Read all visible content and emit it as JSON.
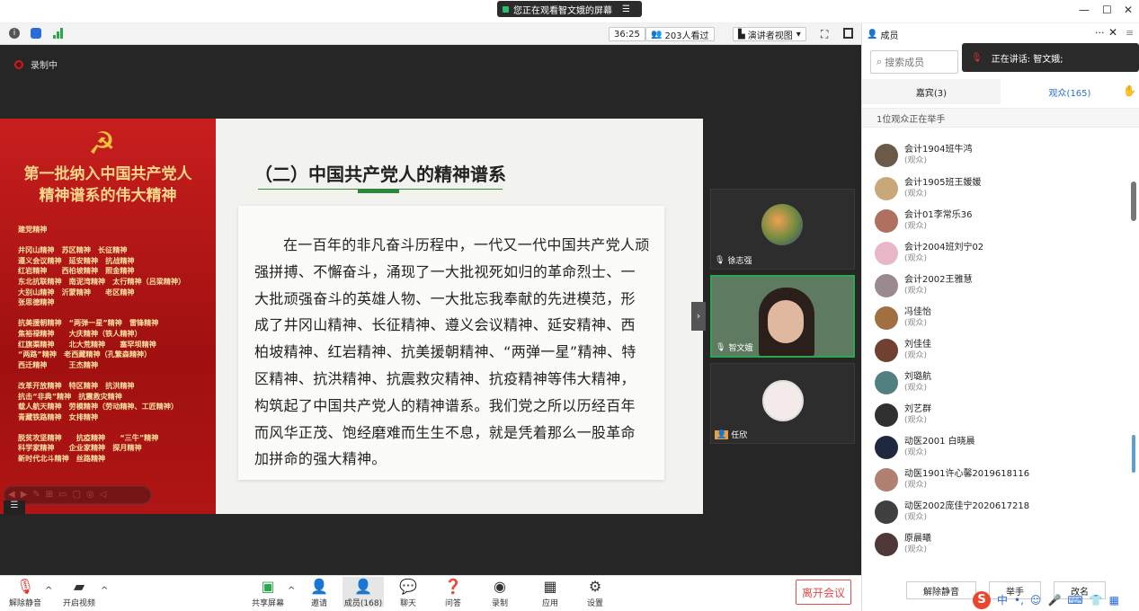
{
  "banner": {
    "text": "您正在观看智文娥的屏幕",
    "menu_icon": "hamburger-icon"
  },
  "window_controls": [
    "—",
    "☐",
    "✕"
  ],
  "toolbar": {
    "timer": "36:25",
    "viewers": "203人看过",
    "view_mode": "演讲者视图"
  },
  "recording": {
    "label": "录制中"
  },
  "slide": {
    "left_title": "第一批纳入中国共产党人\n精神谱系的伟大精神",
    "spirit_list": "建党精神\n\n井冈山精神　苏区精神　长征精神\n遵义会议精神　延安精神　抗战精神\n红岩精神　　西柏坡精神　照金精神\n东北抗联精神　南泥湾精神　太行精神（吕梁精神）\n大别山精神　沂蒙精神　　老区精神\n张思德精神\n\n抗美援朝精神　“两弹一星”精神　雷锋精神\n焦裕禄精神　　大庆精神（铁人精神）\n红旗渠精神　　北大荒精神　　塞罕坝精神\n“两路”精神　老西藏精神（孔繁森精神）\n西迁精神　　　王杰精神\n\n改革开放精神　特区精神　抗洪精神\n抗击“非典”精神　抗震救灾精神\n载人航天精神　劳模精神（劳动精神、工匠精神）\n青藏铁路精神　女排精神\n\n脱贫攻坚精神　　抗疫精神　　“三牛”精神\n科学家精神　　企业家精神　探月精神\n新时代北斗精神　丝路精神",
    "title": "（二）中国共产党人的精神谱系",
    "body": "在一百年的非凡奋斗历程中，一代又一代中国共产党人顽强拼搏、不懈奋斗，涌现了一大批视死如归的革命烈士、一大批顽强奋斗的英雄人物、一大批忘我奉献的先进模范，形成了井冈山精神、长征精神、遵义会议精神、延安精神、西柏坡精神、红岩精神、抗美援朝精神、“两弹一星”精神、特区精神、抗洪精神、抗震救灾精神、抗疫精神等伟大精神，构筑起了中国共产党人的精神谱系。我们党之所以历经百年而风华正茂、饱经磨难而生生不息，就是凭着那么一股革命加拼命的强大精神。"
  },
  "video_tiles": [
    {
      "name": "徐志强"
    },
    {
      "name": "智文娥"
    },
    {
      "name": "任欣"
    }
  ],
  "bottom_toolbar": {
    "mute": "解除静音",
    "video": "开启视频",
    "share": "共享屏幕",
    "invite": "邀请",
    "members": "成员(168)",
    "chat": "聊天",
    "qa": "问答",
    "record": "录制",
    "apps": "应用",
    "settings": "设置",
    "leave": "离开会议"
  },
  "sidebar": {
    "header": "成员",
    "more": "···",
    "search_placeholder": "搜索成员",
    "speaking": "正在讲话: 智文娥;",
    "tab_guests": "嘉宾(3)",
    "tab_audience": "观众(165)",
    "raise_notice": "1位观众正在举手",
    "members": [
      {
        "name": "会计1904班牛鸿",
        "role": "(观众)",
        "color": "#6b5a48"
      },
      {
        "name": "会计1905班王媛媛",
        "role": "(观众)",
        "color": "#c8a878"
      },
      {
        "name": "会计01李常乐36",
        "role": "(观众)",
        "color": "#b07060"
      },
      {
        "name": "会计2004班刘宁02",
        "role": "(观众)",
        "color": "#e8b8c8"
      },
      {
        "name": "会计2002王雅慧",
        "role": "(观众)",
        "color": "#9a8a90"
      },
      {
        "name": "冯佳怡",
        "role": "(观众)",
        "color": "#a07040"
      },
      {
        "name": "刘佳佳",
        "role": "(观众)",
        "color": "#704030"
      },
      {
        "name": "刘璐航",
        "role": "(观众)",
        "color": "#508080"
      },
      {
        "name": "刘艺群",
        "role": "(观众)",
        "color": "#303030"
      },
      {
        "name": "动医2001 白晓晨",
        "role": "(观众)",
        "color": "#202840"
      },
      {
        "name": "动医1901许心馨2019618116",
        "role": "(观众)",
        "color": "#b08070"
      },
      {
        "name": "动医2002庞佳宁2020617218",
        "role": "(观众)",
        "color": "#404040"
      },
      {
        "name": "原晨曦",
        "role": "(观众)",
        "color": "#503838"
      }
    ],
    "btn_unmute": "解除静音",
    "btn_raise": "举手",
    "btn_rename": "改名"
  },
  "ime": {
    "brand": "S",
    "items": [
      "中",
      "•,",
      "☺",
      "🎤",
      "⌨",
      "👕",
      "▦"
    ]
  }
}
